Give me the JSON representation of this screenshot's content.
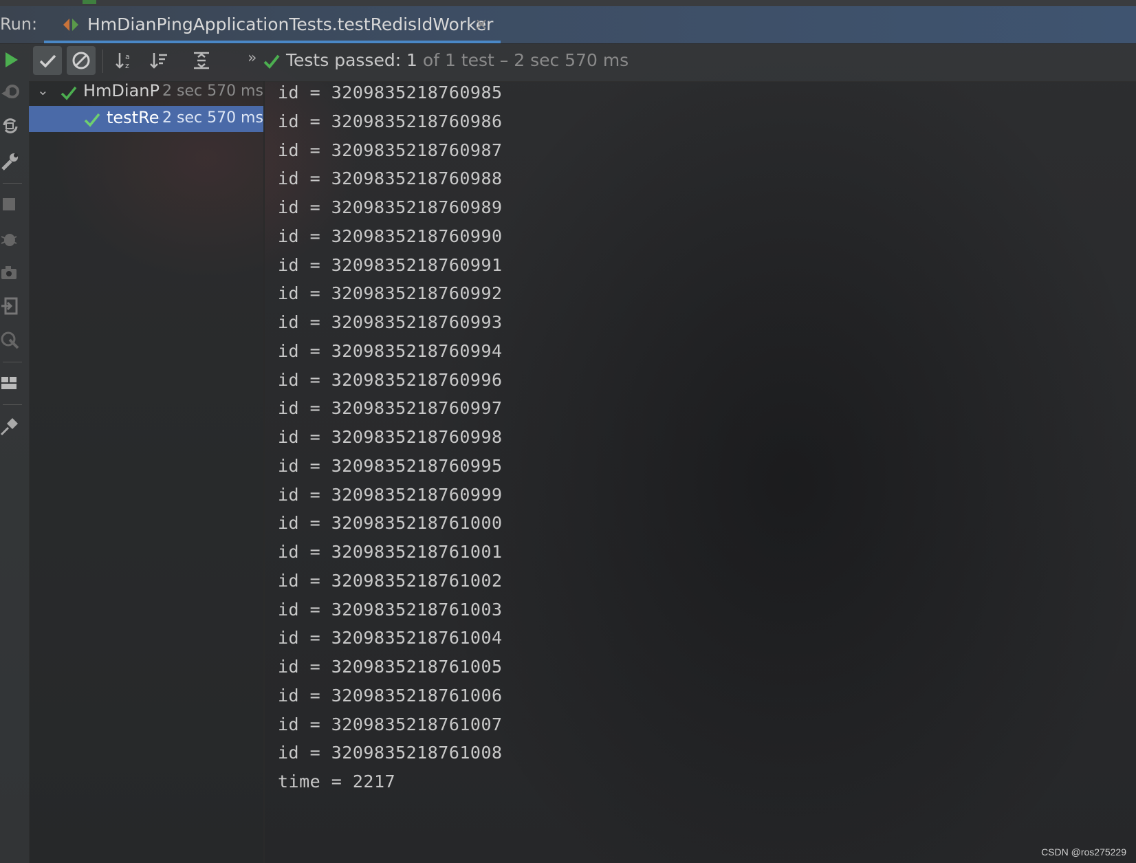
{
  "run_header": {
    "label": "Run:",
    "tab_title": "HmDianPingApplicationTests.testRedisIdWorker",
    "close_glyph": "×"
  },
  "side_toolbar_icons": [
    "run-icon",
    "rerun-failed-icon",
    "toggle-auto-test-icon",
    "settings-wrench-icon",
    "stop-icon",
    "debug-icon",
    "camera-icon",
    "import-icon",
    "coverage-icon",
    "layout-icon",
    "pin-icon"
  ],
  "test_toolbar": {
    "more_glyph": "»",
    "status_passed": "Tests passed: 1",
    "status_detail": " of 1 test – 2 sec 570 ms"
  },
  "tree": {
    "items": [
      {
        "name": "HmDianPi",
        "duration": "2 sec 570 ms"
      },
      {
        "name": "testRec",
        "duration": "2 sec 570 ms"
      }
    ]
  },
  "console": {
    "lines": [
      "id = 320983521876098 5",
      "id = 3209835218760986",
      "id = 3209835218760987",
      "id = 3209835218760988",
      "id = 3209835218760989",
      "id = 3209835218760990",
      "id = 3209835218760991",
      "id = 3209835218760992",
      "id = 3209835218760993",
      "id = 3209835218760994",
      "id = 3209835218760996",
      "id = 3209835218760997",
      "id = 3209835218760998",
      "id = 3209835218760995",
      "id = 3209835218760999",
      "id = 3209835218761000",
      "id = 3209835218761001",
      "id = 3209835218761002",
      "id = 3209835218761003",
      "id = 3209835218761004",
      "id = 3209835218761005",
      "id = 3209835218761006",
      "id = 3209835218761007",
      "id = 3209835218761008",
      "time = 2217"
    ]
  },
  "watermark": "CSDN @ros275229",
  "colors": {
    "accent_blue": "#4a88c7",
    "selection": "#4a6aa8",
    "success_green": "#499c54"
  }
}
